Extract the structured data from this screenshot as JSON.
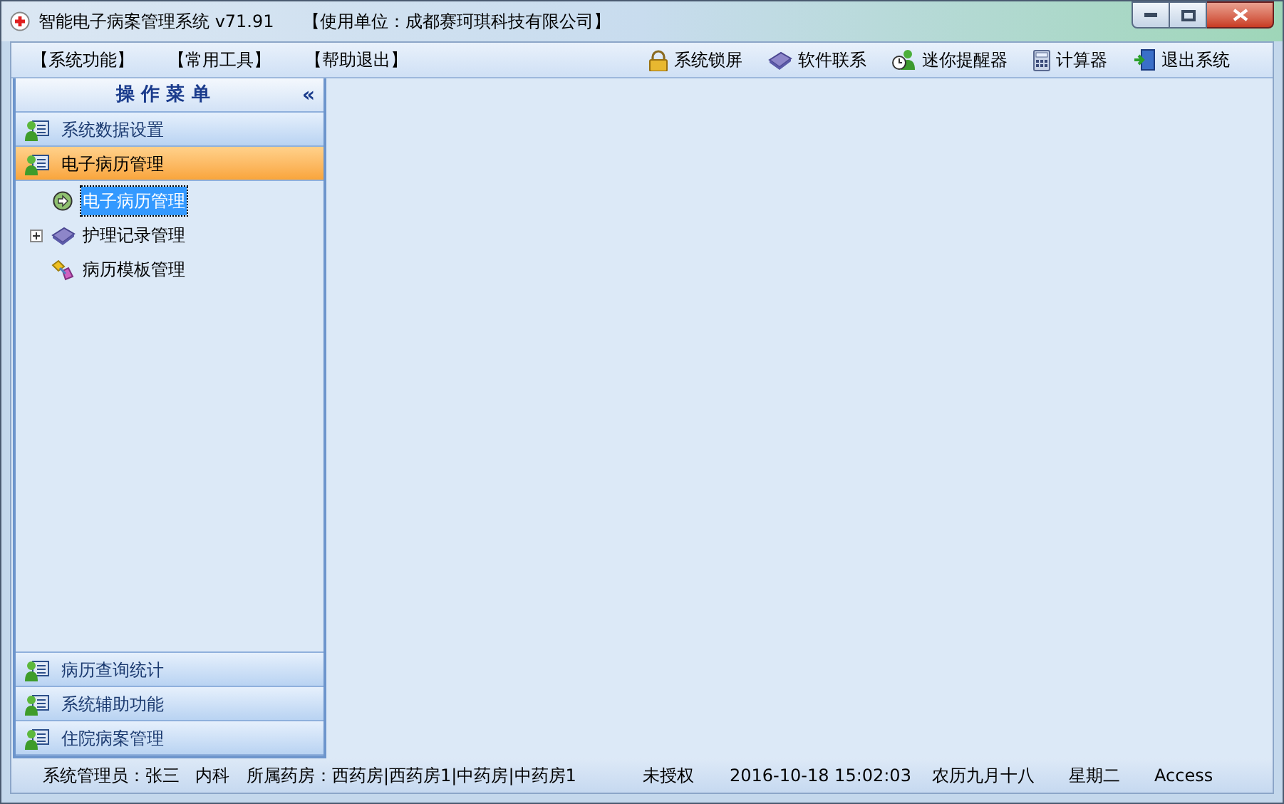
{
  "window": {
    "title": "智能电子病案管理系统 v71.91",
    "org": "【使用单位：成都赛珂琪科技有限公司】"
  },
  "menu": [
    "【系统功能】",
    "【常用工具】",
    "【帮助退出】"
  ],
  "toolbar": [
    {
      "kind": "lock",
      "label": "系统锁屏"
    },
    {
      "kind": "book",
      "label": "软件联系"
    },
    {
      "kind": "reminder",
      "label": "迷你提醒器"
    },
    {
      "kind": "calculator",
      "label": "计算器"
    },
    {
      "kind": "exit",
      "label": "退出系统"
    }
  ],
  "sidebar": {
    "title": "操 作 菜 单",
    "collapse": "«",
    "sections_top": [
      {
        "label": "系统数据设置",
        "selected": false
      },
      {
        "label": "电子病历管理",
        "selected": true
      }
    ],
    "tree": [
      {
        "kind": "run",
        "label": "电子病历管理",
        "selected": true
      },
      {
        "kind": "book",
        "label": "护理记录管理",
        "selected": false,
        "expanded": false
      },
      {
        "kind": "template",
        "label": "病历模板管理",
        "selected": false
      }
    ],
    "sections_bottom": [
      {
        "label": "病历查询统计",
        "selected": false
      },
      {
        "label": "系统辅助功能",
        "selected": false
      },
      {
        "label": "住院病案管理",
        "selected": false
      }
    ]
  },
  "status_bar": [
    "系统管理员：张三",
    "内科",
    "所属药房：西药房|西药房1|中药房|中药房1",
    "未授权",
    "2016-10-18 15:02:03",
    "农历九月十八",
    "星期二",
    "Access"
  ]
}
